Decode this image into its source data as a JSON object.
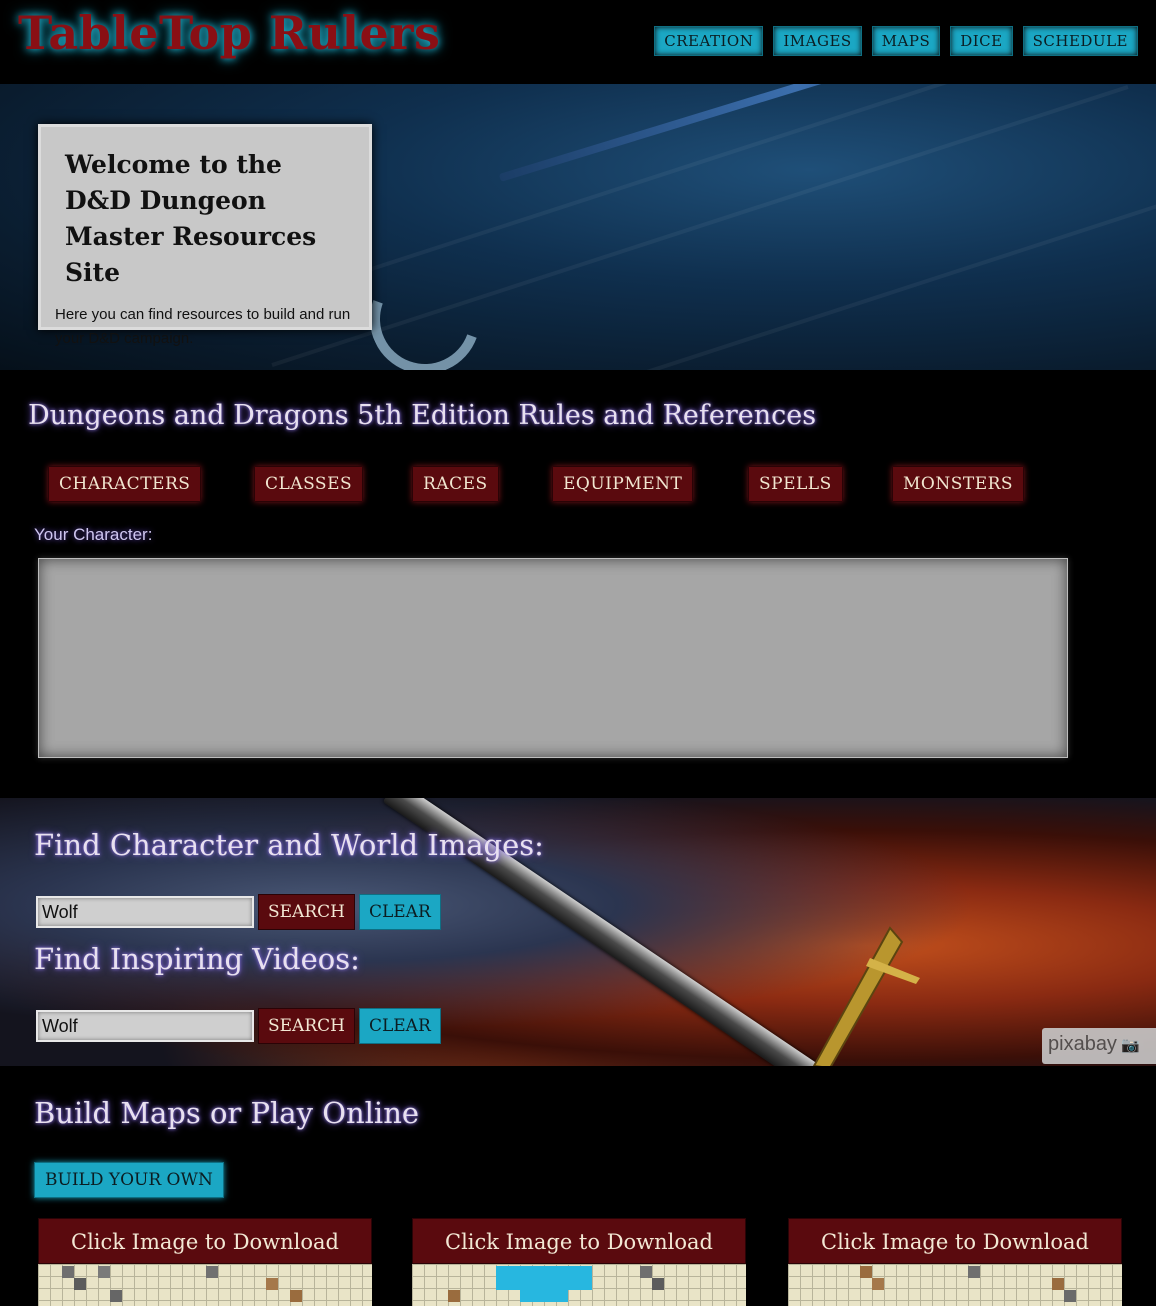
{
  "header": {
    "logo": "TableTop Rulers",
    "nav": [
      "CREATION",
      "IMAGES",
      "MAPS",
      "DICE",
      "SCHEDULE"
    ]
  },
  "hero": {
    "title": "Welcome to the D&D Dungeon Master Resources Site",
    "subtitle": "Here you can find resources to build and run your D&D campaign."
  },
  "rules": {
    "title": "Dungeons and Dragons 5th Edition Rules and References",
    "tabs": [
      "CHARACTERS",
      "CLASSES",
      "RACES",
      "EQUIPMENT",
      "SPELLS",
      "MONSTERS"
    ],
    "character_label": "Your Character:"
  },
  "images_search": {
    "title": "Find Character and World Images:",
    "value": "Wolf",
    "search_label": "SEARCH",
    "clear_label": "CLEAR"
  },
  "videos_search": {
    "title": "Find Inspiring Videos:",
    "value": "Wolf",
    "search_label": "SEARCH",
    "clear_label": "CLEAR"
  },
  "pixabay": "pixabay",
  "maps": {
    "title": "Build Maps or Play Online",
    "build_label": "BUILD YOUR OWN",
    "cards": [
      "Click Image to Download",
      "Click Image to Download",
      "Click Image to Download"
    ]
  },
  "colors": {
    "accent_teal": "#1ba7c4",
    "accent_maroon": "#5a0a0e",
    "logo_red": "#8a0f14"
  }
}
